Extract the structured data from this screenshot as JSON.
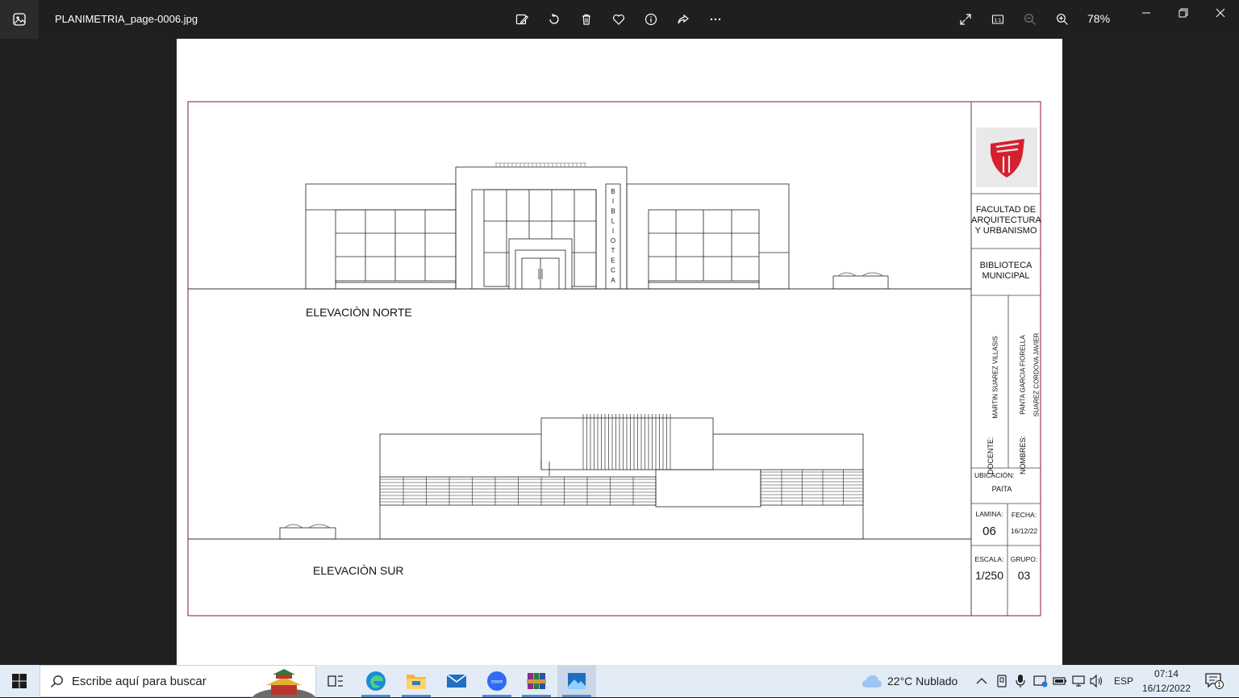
{
  "window": {
    "file_name": "PLANIMETRIA_page-0006.jpg",
    "zoom": "78%",
    "toolbar_icons": [
      "edit-image-icon",
      "rotate-icon",
      "delete-icon",
      "favorite-icon",
      "info-icon",
      "share-icon",
      "more-icon"
    ],
    "view_icons": [
      "fullscreen-icon",
      "actual-size-icon",
      "zoom-out-icon",
      "zoom-in-icon"
    ]
  },
  "drawing": {
    "north_label": "ELEVACIÒN NORTE",
    "south_label": "ELEVACIÒN SUR",
    "vertical_sign": [
      "B",
      "I",
      "B",
      "L",
      "I",
      "O",
      "T",
      "E",
      "C",
      "A"
    ]
  },
  "title_block": {
    "faculty": [
      "FACULTAD DE",
      "ARQUITECTURA",
      "Y URBANISMO"
    ],
    "project": [
      "BIBLIOTECA",
      "MUNICIPAL"
    ],
    "docente_label": "DOCENTE:",
    "docente": "MARTIN SUAREZ VILLASIS",
    "nombres_label": "NOMBRES:",
    "nombre_1": "PANTA GARCIA FIORELLA",
    "nombre_2": "SUAREZ CORDOVA JAVIER",
    "ubicacion_label": "UBICACIÓN:",
    "ubicacion": "PAITA",
    "lamina_label": "LAMINA:",
    "lamina": "06",
    "fecha_label": "FECHA:",
    "fecha": "16/12/22",
    "escala_label": "ESCALA:",
    "escala": "1/250",
    "grupo_label": "GRUPO:",
    "grupo": "03"
  },
  "taskbar": {
    "search_placeholder": "Escribe aquí para buscar",
    "weather": "22°C  Nublado",
    "language": "ESP",
    "time": "07:14",
    "date": "16/12/2022",
    "notification_count": "1"
  },
  "colors": {
    "logo_red": "#d5202f",
    "frame_line": "#8b1a2a",
    "titlebar_bg": "#1f1f1f",
    "taskbar_bg": "#e3ecf6"
  }
}
